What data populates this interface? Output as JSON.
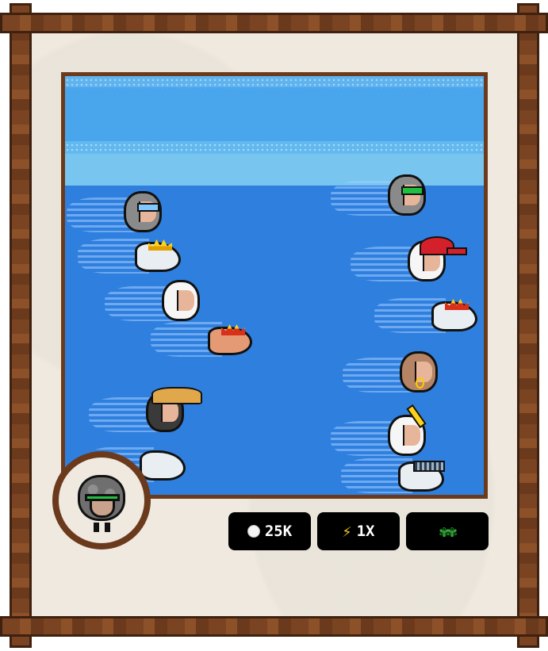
{
  "stats": {
    "coins": {
      "icon": "coin-icon",
      "value": "25K"
    },
    "multiplier": {
      "icon": "lightning-bolt-icon",
      "value": "1X",
      "glyph": "⚡"
    },
    "herbs": {
      "icon": "herb-icon",
      "glyph": "✾✾"
    }
  },
  "player": {
    "avatar": "gray-sheep-with-green-shades"
  },
  "colors": {
    "frame": "#7a4322",
    "paper": "#efe9df",
    "sky": "#4aa6ec",
    "water": "#2f7fdf",
    "button_bg": "#000000"
  }
}
